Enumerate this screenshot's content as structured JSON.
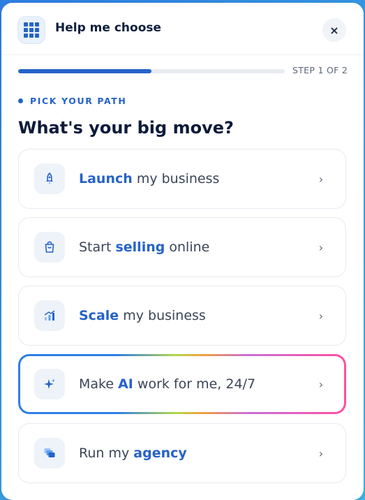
{
  "header": {
    "title": "Help me choose",
    "grid_icon": "grid-icon",
    "close_label": "×"
  },
  "progress": {
    "step_label": "STEP 1 OF 2",
    "fraction": 0.5
  },
  "eyebrow": "PICK YOUR PATH",
  "question": "What's your big move?",
  "options": [
    {
      "icon": "rocket-icon",
      "pre": "",
      "bold": "Launch",
      "post": " my business"
    },
    {
      "icon": "shopping-bag-icon",
      "pre": "Start ",
      "bold": "selling",
      "post": " online"
    },
    {
      "icon": "growth-chart-icon",
      "pre": "",
      "bold": "Scale",
      "post": " my business"
    },
    {
      "icon": "sparkle-icon",
      "pre": "Make ",
      "bold": "AI",
      "post": " work for me, 24/7"
    },
    {
      "icon": "layered-windows-icon",
      "pre": "Run my ",
      "bold": "agency",
      "post": ""
    }
  ],
  "colors": {
    "accent": "#2563c9",
    "highlight_gradient": [
      "#2f7ee6",
      "#b3d84a",
      "#f2a23a",
      "#c76fd8",
      "#ff4fa0"
    ]
  }
}
